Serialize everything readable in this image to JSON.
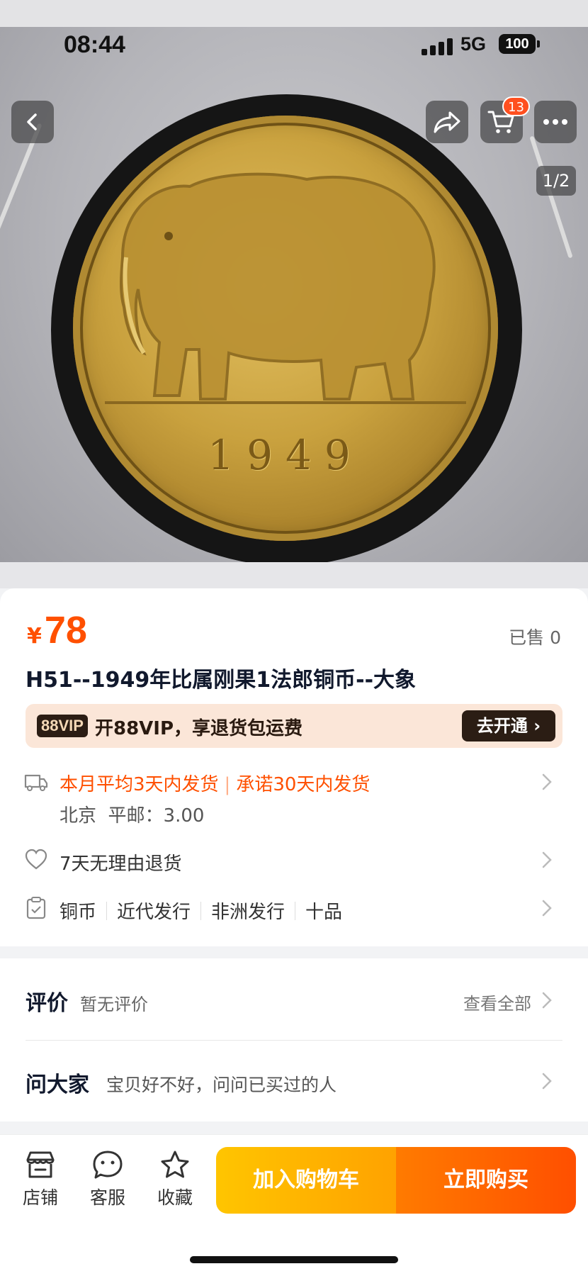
{
  "status": {
    "time": "08:44",
    "network": "5G",
    "battery": "100"
  },
  "header": {
    "cart_count": "13",
    "page_indicator": "1/2"
  },
  "product_image": {
    "coin_year": "1949"
  },
  "price": {
    "currency": "¥",
    "amount": "78",
    "sold": "已售 0"
  },
  "title": "H51--1949年比属刚果1法郎铜币--大象",
  "vip": {
    "tag": "88VIP",
    "text": "开88VIP，享退货包运费",
    "button": "去开通"
  },
  "shipping": {
    "avg": "本月平均3天内发货",
    "promise": "承诺30天内发货",
    "from": "北京",
    "postage": "平邮：3.00"
  },
  "return_policy": "7天无理由退货",
  "tags": [
    "铜币",
    "近代发行",
    "非洲发行",
    "十品"
  ],
  "reviews": {
    "title": "评价",
    "subtitle": "暂无评价",
    "view_all": "查看全部"
  },
  "ask": {
    "title": "问大家",
    "subtitle": "宝贝好不好，问问已买过的人"
  },
  "bottom_bar": {
    "store": "店铺",
    "service": "客服",
    "favorite": "收藏",
    "add_to_cart": "加入购物车",
    "buy_now": "立即购买"
  },
  "colors": {
    "accent": "#ff5000",
    "cart_button": "#ffb300",
    "buy_button": "#ff6000"
  }
}
